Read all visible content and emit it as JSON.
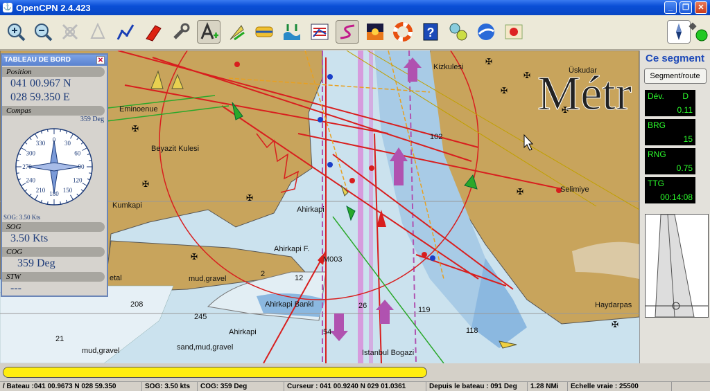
{
  "app": {
    "title": "OpenCPN 2.4.423"
  },
  "window_buttons": {
    "minimize": "_",
    "maximize": "❐",
    "close": "✕"
  },
  "dashboard": {
    "title": "TABLEAU DE BORD",
    "close": "✕",
    "position_caption": "Position",
    "lat": "041 00.967 N",
    "lon": "028 59.350 E",
    "compass_caption": "Compas",
    "compass_heading": "359 Deg",
    "compass_sog": "SOG: 3.50 Kts",
    "sog_caption": "SOG",
    "sog_value": "3.50 Kts",
    "cog_caption": "COG",
    "cog_value": "359 Deg",
    "stw_caption": "STW",
    "stw_value": "---",
    "compass_ticks": [
      "0",
      "30",
      "60",
      "90",
      "120",
      "150",
      "180",
      "210",
      "240",
      "270",
      "300",
      "330"
    ]
  },
  "segment": {
    "title": "Ce segment",
    "button": "Segment/route",
    "dev_label": "Dév.",
    "dev_dir": "D",
    "dev_value": "0.11",
    "brg_label": "BRG",
    "brg_value": "15",
    "rng_label": "RNG",
    "rng_value": "0.75",
    "ttg_label": "TTG",
    "ttg_value": "00:14:08"
  },
  "map": {
    "labels": {
      "eminonu": "Eminoenue",
      "beyazit": "Beyazit Kulesi",
      "kumkapi": "Kumkapi",
      "ahirkapi_top": "Ahirkapi",
      "ahirkapi_fn": "Ahirkapi F.",
      "m003": "M003",
      "bankl": "Ahirkapi Bankl",
      "ahirkapi": "Ahirkapi",
      "mudgravel1": "mud,gravel",
      "sandmud": "sand,mud,gravel",
      "mudgravel2": "mud,gravel",
      "istanbul": "Istanbul Bogazi",
      "kizkulesi": "Kizkulesi",
      "uskudar": "Üskudar",
      "selimiye": "Selimiye",
      "haydarpas": "Haydarpas",
      "metre": "Métr",
      "etal": "etal",
      "d21": "21",
      "d208": "208",
      "d245": "245",
      "d54": "54",
      "d26": "26",
      "d119": "119",
      "d118": "118",
      "d102": "102",
      "d12": "12",
      "d2": "2"
    }
  },
  "status": {
    "bateau": "/ Bateau :041 00.9673 N   028 59.350",
    "sog": "SOG:  3.50 kts",
    "cog": "COG:    359 Deg",
    "cursor": "Curseur : 041 00.9240 N 029 01.0361",
    "depuis": "Depuis le bateau : 091 Deg",
    "dist": "1.28 NMi",
    "scale": "Echelle vraie :   25500"
  },
  "progress": {
    "fraction": 0.98
  },
  "colors": {
    "accent": "#1c48b8",
    "progress": "#ffee10",
    "land": "#c8a45c",
    "water": "#cbe2ee",
    "route": "#d81e1e"
  }
}
